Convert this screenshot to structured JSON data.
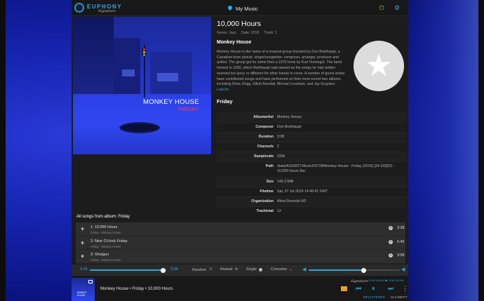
{
  "header": {
    "logo_text": "EUPHONY",
    "logo_signature": "Signature",
    "view_title": "My Music"
  },
  "cover": {
    "artist_text": "MONKEY HOUSE",
    "album_text": "FRIDAY"
  },
  "track": {
    "title": "10,000 Hours",
    "genre": "Genre: Jazz",
    "date": "Date: 2019",
    "track_no": "Track: 1"
  },
  "artist": {
    "name": "Monkey House",
    "bio": "Monkey House is the name of a musical group founded by Don Breithaupt, a Canadian-born pianist, singer/songwriter, composer, arranger, producer and author. The group got its name from a 1970 book by Kurt Vonnegut. The band formed in 1992, which Breithaupt said started as the songs he had written seemed too jazzy or different for other bands to cover. A number of guest artists have contributed songs and have performed on their most recent two albums, including Drew Zingg, Elliott Randall, Michael Leonhart, and Jay Graydon.",
    "bio_link": "Last.fm"
  },
  "album": {
    "name": "Friday"
  },
  "metadata": [
    {
      "key": "Albumartist",
      "value": "Monkey House"
    },
    {
      "key": "Composer",
      "value": "Don Breithaupt"
    },
    {
      "key": "Duration",
      "value": "3:38"
    },
    {
      "key": "Channels",
      "value": "2"
    },
    {
      "key": "Samplerate",
      "value": "192k"
    },
    {
      "key": "Path",
      "value": "/data/AS1002T-Music2/0728/Monkey House - Friday (2019) [24-192]/01 - 10,000 Hours.flac"
    },
    {
      "key": "Size",
      "value": "146.3 MiB"
    },
    {
      "key": "Filetime",
      "value": "Sat, 27 Jul 2019 14:48:41 GMT"
    },
    {
      "key": "Organization",
      "value": "Alma Records HD"
    },
    {
      "key": "Tracktotal",
      "value": "12"
    }
  ],
  "songs": {
    "heading": "All songs from album: Friday",
    "items": [
      {
        "title": "1: 10,000 Hours",
        "sub": "Friday - Monkey House",
        "duration": "3:38"
      },
      {
        "title": "2: Nine O'clock Friday",
        "sub": "Friday - Monkey House",
        "duration": "5:45"
      },
      {
        "title": "3: Shotgun",
        "sub": "Friday - Monkey House",
        "duration": "3:58"
      }
    ]
  },
  "controls": {
    "position": "3:28",
    "total": "3:38",
    "seek_fraction": 0.95,
    "random_label": "Random",
    "repeat_label": "Repeat",
    "single_label": "Single",
    "consume_label": "Consume",
    "volume_fraction": 0.6
  },
  "now_playing": {
    "text": "Monkey House • Friday • 10,000 Hours",
    "signature": "Signature",
    "format": "PCM 24/192 ▶ PCM 32/192",
    "registered": "REGISTERED",
    "version": "v3.2.0/607/7"
  },
  "colors": {
    "accent": "#2aa8e8",
    "power": "#8ccf3a",
    "queue": "#e8a030",
    "album_subtitle": "#ff4060"
  }
}
